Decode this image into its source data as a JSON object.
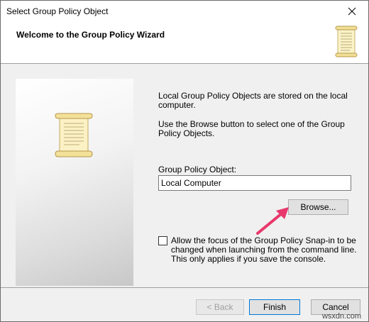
{
  "window": {
    "title": "Select Group Policy Object",
    "close_icon": "close-icon"
  },
  "header": {
    "title": "Welcome to the Group Policy Wizard",
    "icon": "scroll-icon"
  },
  "side_panel": {
    "icon": "scroll-icon"
  },
  "body": {
    "paragraph1": "Local Group Policy Objects are stored on the local computer.",
    "paragraph2": "Use the Browse button to select one of the Group Policy Objects.",
    "gpo_label": "Group Policy Object:",
    "gpo_value": "Local Computer",
    "browse_label": "Browse...",
    "checkbox_label": "Allow the focus of the Group Policy Snap-in to be changed when launching from the command line. This only applies if you save the console.",
    "checkbox_checked": false
  },
  "annotation": {
    "arrow_color": "#e8386b"
  },
  "footer": {
    "back_label": "< Back",
    "finish_label": "Finish",
    "cancel_label": "Cancel"
  },
  "watermark": "wsxdn.com",
  "colors": {
    "accent": "#0078d7",
    "window_bg": "#f0f0f0"
  }
}
